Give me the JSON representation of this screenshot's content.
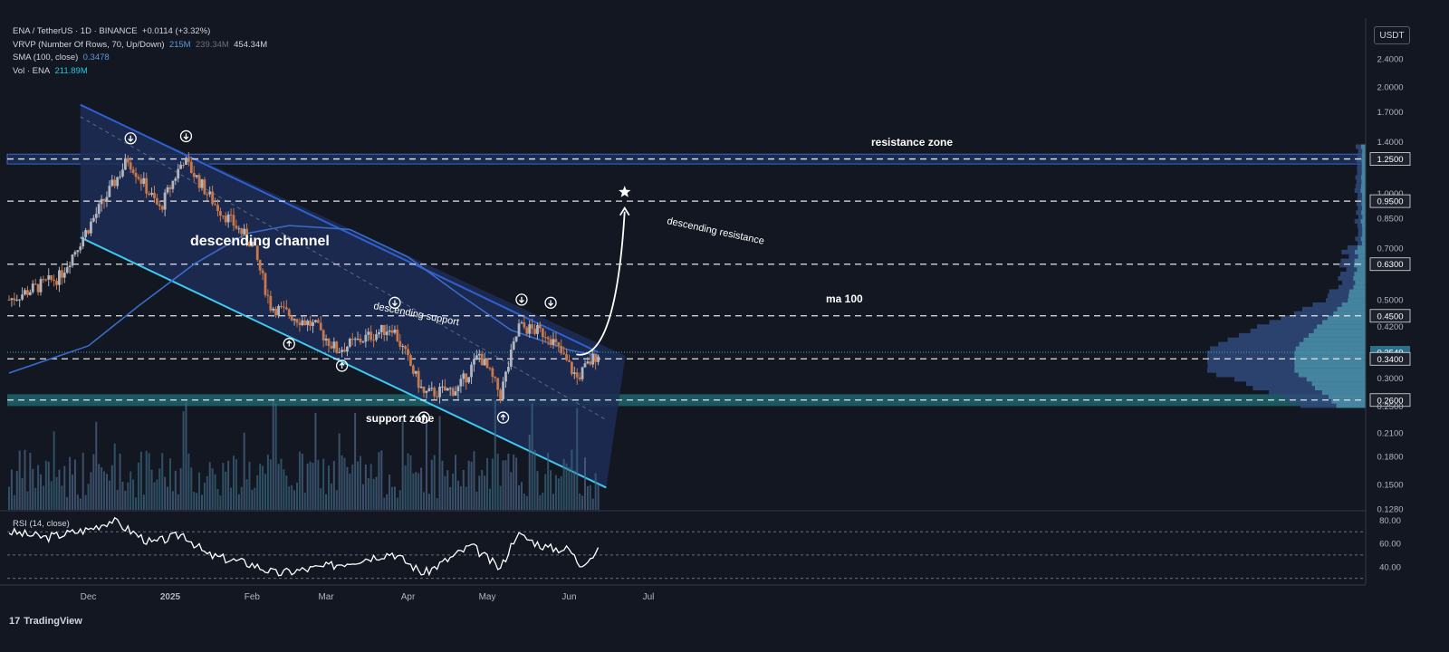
{
  "header": {
    "symbol_line": "ENA / TetherUS · 1D · BINANCE",
    "change": "+0.0114 (+3.32%)",
    "vrvp_label": "VRVP (Number Of Rows, 70, Up/Down)",
    "vrvp_up": "215M",
    "vrvp_down": "239.34M",
    "vrvp_total": "454.34M",
    "sma_label": "SMA (100, close)",
    "sma_value": "0.3478",
    "vol_label": "Vol · ENA",
    "vol_value": "211.89M",
    "currency_button": "USDT"
  },
  "branding": {
    "logo_text": "TradingView",
    "logo_mark": "17"
  },
  "colors": {
    "background": "#131722",
    "up": "#b2b5be",
    "down": "#c8784a",
    "channel_fill": "#1c2d55",
    "channel_upper": "#2f5fd0",
    "channel_lower": "#3ec8ef",
    "sma": "#3a6bc9",
    "zone": "#1e5f66",
    "rsi_line": "#ffffff"
  },
  "annotations": {
    "channel_title": "descending channel",
    "upper_label": "descending resistance",
    "lower_label": "descending support",
    "ma_label": "ma 100",
    "resistance_zone": "resistance zone",
    "support_zone": "support zone",
    "target_icon": "star-icon"
  },
  "chart_data": {
    "type": "candlestick",
    "title": "ENA / TetherUS · 1D · BINANCE",
    "scale": "log",
    "ylim": [
      0.128,
      2.8
    ],
    "x_ticks": [
      "Dec",
      "2025",
      "Feb",
      "Mar",
      "Apr",
      "May",
      "Jun",
      "Jul"
    ],
    "y_ticks": [
      "2.4000",
      "2.0000",
      "1.7000",
      "1.4000",
      "1.2500",
      "1.0000",
      "0.9500",
      "0.8500",
      "0.7000",
      "0.6300",
      "0.5000",
      "0.4500",
      "0.4200",
      "0.3549",
      "0.3400",
      "0.3000",
      "0.2600",
      "0.2500",
      "0.2100",
      "0.1800",
      "0.1500",
      "0.1280"
    ],
    "highlighted_levels": [
      "1.2500",
      "0.9500",
      "0.6300",
      "0.4500",
      "0.3549",
      "0.3400",
      "0.2600"
    ],
    "horizontal_levels": [
      1.25,
      0.95,
      0.63,
      0.45,
      0.34,
      0.26
    ],
    "current_price": 0.3549,
    "resistance_zone": [
      1.21,
      1.29
    ],
    "support_zone": [
      0.25,
      0.27
    ],
    "channel": {
      "upper": {
        "start": [
          "2024-11-28",
          1.78
        ],
        "end": [
          "2025-06-12",
          0.355
        ]
      },
      "lower": {
        "start": [
          "2024-11-28",
          0.75
        ],
        "end": [
          "2025-06-15",
          0.147
        ]
      }
    },
    "sma_period": 100,
    "sma": [
      {
        "date": "2024-11-01",
        "v": 0.31
      },
      {
        "date": "2024-12-01",
        "v": 0.37
      },
      {
        "date": "2024-12-20",
        "v": 0.48
      },
      {
        "date": "2025-01-10",
        "v": 0.63
      },
      {
        "date": "2025-01-30",
        "v": 0.77
      },
      {
        "date": "2025-02-15",
        "v": 0.81
      },
      {
        "date": "2025-03-10",
        "v": 0.79
      },
      {
        "date": "2025-04-01",
        "v": 0.66
      },
      {
        "date": "2025-04-20",
        "v": 0.52
      },
      {
        "date": "2025-05-10",
        "v": 0.41
      },
      {
        "date": "2025-06-01",
        "v": 0.36
      },
      {
        "date": "2025-06-12",
        "v": 0.3478
      }
    ],
    "price_path": [
      {
        "date": "2024-11-01",
        "v": 0.5
      },
      {
        "date": "2024-11-20",
        "v": 0.58
      },
      {
        "date": "2024-12-01",
        "v": 0.8
      },
      {
        "date": "2024-12-16",
        "v": 1.25
      },
      {
        "date": "2024-12-28",
        "v": 0.9
      },
      {
        "date": "2025-01-06",
        "v": 1.25
      },
      {
        "date": "2025-01-18",
        "v": 0.93
      },
      {
        "date": "2025-02-01",
        "v": 0.72
      },
      {
        "date": "2025-02-08",
        "v": 0.48
      },
      {
        "date": "2025-02-25",
        "v": 0.42
      },
      {
        "date": "2025-03-05",
        "v": 0.36
      },
      {
        "date": "2025-03-26",
        "v": 0.42
      },
      {
        "date": "2025-04-07",
        "v": 0.27
      },
      {
        "date": "2025-04-20",
        "v": 0.28
      },
      {
        "date": "2025-04-28",
        "v": 0.35
      },
      {
        "date": "2025-05-06",
        "v": 0.27
      },
      {
        "date": "2025-05-13",
        "v": 0.42
      },
      {
        "date": "2025-05-24",
        "v": 0.4
      },
      {
        "date": "2025-06-04",
        "v": 0.3
      },
      {
        "date": "2025-06-12",
        "v": 0.3549
      }
    ],
    "down_arrows": [
      {
        "date": "2024-12-17",
        "v": 1.43
      },
      {
        "date": "2025-01-07",
        "v": 1.45
      },
      {
        "date": "2025-03-27",
        "v": 0.49
      },
      {
        "date": "2025-05-14",
        "v": 0.5
      },
      {
        "date": "2025-05-25",
        "v": 0.49
      }
    ],
    "up_arrows": [
      {
        "date": "2025-02-15",
        "v": 0.375
      },
      {
        "date": "2025-03-07",
        "v": 0.325
      },
      {
        "date": "2025-04-07",
        "v": 0.232
      },
      {
        "date": "2025-05-07",
        "v": 0.232
      }
    ],
    "projection": {
      "from": [
        "2025-06-14",
        0.35
      ],
      "to": [
        "2025-06-22",
        0.93
      ],
      "target": 0.95
    },
    "volume": {
      "unit": "M",
      "last": 211.89
    },
    "rsi": {
      "label": "RSI (14, close)",
      "ylim": [
        25,
        85
      ],
      "ticks": [
        "80.00",
        "60.00",
        "40.00"
      ],
      "levels": [
        70,
        50,
        30
      ],
      "points": [
        {
          "date": "2024-11-01",
          "v": 70
        },
        {
          "date": "2024-11-15",
          "v": 65
        },
        {
          "date": "2024-12-01",
          "v": 72
        },
        {
          "date": "2024-12-10",
          "v": 80
        },
        {
          "date": "2024-12-25",
          "v": 60
        },
        {
          "date": "2025-01-06",
          "v": 68
        },
        {
          "date": "2025-01-15",
          "v": 50
        },
        {
          "date": "2025-02-01",
          "v": 42
        },
        {
          "date": "2025-02-10",
          "v": 34
        },
        {
          "date": "2025-03-01",
          "v": 40
        },
        {
          "date": "2025-03-26",
          "v": 52
        },
        {
          "date": "2025-04-07",
          "v": 34
        },
        {
          "date": "2025-04-25",
          "v": 58
        },
        {
          "date": "2025-05-06",
          "v": 38
        },
        {
          "date": "2025-05-12",
          "v": 68
        },
        {
          "date": "2025-05-24",
          "v": 56
        },
        {
          "date": "2025-06-01",
          "v": 55
        },
        {
          "date": "2025-06-05",
          "v": 42
        },
        {
          "date": "2025-06-12",
          "v": 53
        }
      ]
    }
  }
}
